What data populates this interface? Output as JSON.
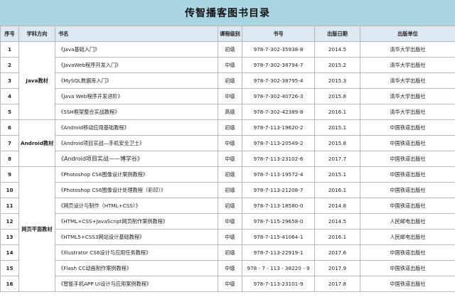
{
  "title": "传智播客图书目录",
  "headers": [
    "序号",
    "学科方向",
    "书名",
    "课程级别",
    "书号",
    "出版日期",
    "出版单位"
  ],
  "categories": [
    "Java教材",
    "Android教材",
    "网页平面教材"
  ],
  "rows": [
    {
      "no": "1",
      "name": "《Java基础入门》",
      "level": "初级",
      "isbn": "978-7-302-35938-8",
      "date": "2014.5",
      "pub": "清华大学出版社"
    },
    {
      "no": "2",
      "name": "《JavaWeb程序开发入门》",
      "level": "中级",
      "isbn": "978-7-302-38794-7",
      "date": "2015.2",
      "pub": "清华大学出版社"
    },
    {
      "no": "3",
      "name": "《MySQL数据库入门》",
      "level": "初级",
      "isbn": "978-7-302-38795-4",
      "date": "2015.3",
      "pub": "清华大学出版社"
    },
    {
      "no": "4",
      "name": "《Java Web程序开发进阶》",
      "level": "中级",
      "isbn": "978-7-302-40726-3",
      "date": "2015.8",
      "pub": "清华大学出版社"
    },
    {
      "no": "5",
      "name": "《SSH框架整合实战教程》",
      "level": "高级",
      "isbn": "978-7-302-42389-8",
      "date": "2016.1",
      "pub": "清华大学出版社"
    },
    {
      "no": "6",
      "name": "《Android移动应用基础教程》",
      "level": "初级",
      "isbn": "978-7-113-19620-2",
      "date": "2015.1",
      "pub": "中国铁道出版社"
    },
    {
      "no": "7",
      "name": "《Android项目实战—手机安全卫士》",
      "level": "中级",
      "isbn": "978-7-113-20549-2",
      "date": "2015.8",
      "pub": "中国铁道出版社"
    },
    {
      "no": "8",
      "name": "《Android项目实战——博学谷》",
      "level": "中级",
      "isbn": "978-7-113-23102-6",
      "date": "2017.7",
      "pub": "中国铁道出版社"
    },
    {
      "no": "9",
      "name": "《Photoshop CS6图像设计案例教程》",
      "level": "初级",
      "isbn": "978-7-113-19572-4",
      "date": "2015.1",
      "pub": "中国铁道出版社"
    },
    {
      "no": "10",
      "name": "《Photoshop CS6图像设计处理教程（彩印）》",
      "level": "初级",
      "isbn": "978-7-113-21208-7",
      "date": "2016.1",
      "pub": "中国铁道出版社"
    },
    {
      "no": "11",
      "name": "《网页设计与制作（HTML+CSS）》",
      "level": "初级",
      "isbn": "978-7-113-18580-0",
      "date": "2014.8",
      "pub": "中国铁道出版社"
    },
    {
      "no": "12",
      "name": "《HTML+CSS+JavaScript网页制作案例教程》",
      "level": "中级",
      "isbn": "978-7-115-29658-0",
      "date": "2014.5",
      "pub": "人民邮电出版社"
    },
    {
      "no": "13",
      "name": "《HTML5+CSS3网站设计基础教程》",
      "level": "中级",
      "isbn": "978-7-115-41064-1",
      "date": "2016.1",
      "pub": "人民邮电出版社"
    },
    {
      "no": "14",
      "name": "《Illustrator CS6设计与应用任务教程》",
      "level": "初级",
      "isbn": "978-7-113-22919-1",
      "date": "2017.6",
      "pub": "中国铁道出版社"
    },
    {
      "no": "15",
      "name": "《Flash CC动画制作案例教程》",
      "level": "中级",
      "isbn": "978 - 7 - 113 - 38220 - 9",
      "date": "2017.9",
      "pub": "中国铁道出版社"
    },
    {
      "no": "16",
      "name": "《智能手机APP UI设计与应用案例教程》",
      "level": "中级",
      "isbn": "978-7-113-23101-9",
      "date": "2017.8",
      "pub": "中国铁道出版社"
    }
  ]
}
